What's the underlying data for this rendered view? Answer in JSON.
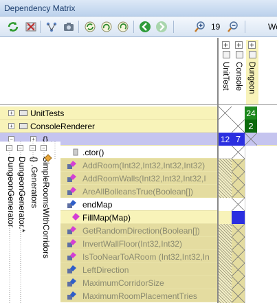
{
  "window": {
    "title": "Dependency Matrix"
  },
  "toolbar": {
    "zoom_value": "19",
    "truncated_label": "We",
    "icons": [
      "refresh-icon",
      "grid-icon",
      "graph-icon",
      "camera-icon",
      "circle-refresh-icon",
      "rotate-icon",
      "undo-icon",
      "back-icon",
      "forward-icon",
      "zoom-in-icon",
      "zoom-out-icon"
    ]
  },
  "columns": [
    {
      "label": "UnitTest"
    },
    {
      "label": "Console"
    },
    {
      "label": "Dungeon"
    }
  ],
  "tree": {
    "top_rows": [
      {
        "label": "UnitTests"
      },
      {
        "label": "ConsoleRenderer"
      },
      {
        "label": "{} ."
      }
    ],
    "method_rows": [
      {
        "label": ".ctor()"
      },
      {
        "label": "AddRoom(Int32,Int32,Int32,Int32)"
      },
      {
        "label": "AddRoomWalls(Int32,Int32,Int32,I"
      },
      {
        "label": "AreAllBolleansTrue(Boolean[])"
      },
      {
        "label": "endMap"
      },
      {
        "label": "FillMap(Map)"
      },
      {
        "label": "GetRandomDirection(Boolean[])"
      },
      {
        "label": "InvertWallFloor(Int32,Int32)"
      },
      {
        "label": "IsTooNearToARoom (Int32,Int32,In"
      },
      {
        "label": "LeftDirection"
      },
      {
        "label": "MaximumCorridorSize"
      },
      {
        "label": "MaximumRoomPlacementTries"
      }
    ],
    "vertical_labels": [
      {
        "label": "DungeonGenerator"
      },
      {
        "label": "DungeonGenerator.*"
      },
      {
        "label": "{} .Generators"
      },
      {
        "label": "SimpleRoomsWithCorridors"
      }
    ]
  },
  "matrix": {
    "row1_value": "24",
    "row2_value": "2",
    "row3_values": [
      "12",
      "7"
    ]
  },
  "colors": {
    "row_yellow": "#f8f3b9",
    "row_tan": "#e4dca0",
    "selected_row": "#c5c4ef",
    "blue_cell": "#2b2fe0",
    "green_cell": "#1e8a1e",
    "dark_green_cell": "#0b6a0b"
  }
}
